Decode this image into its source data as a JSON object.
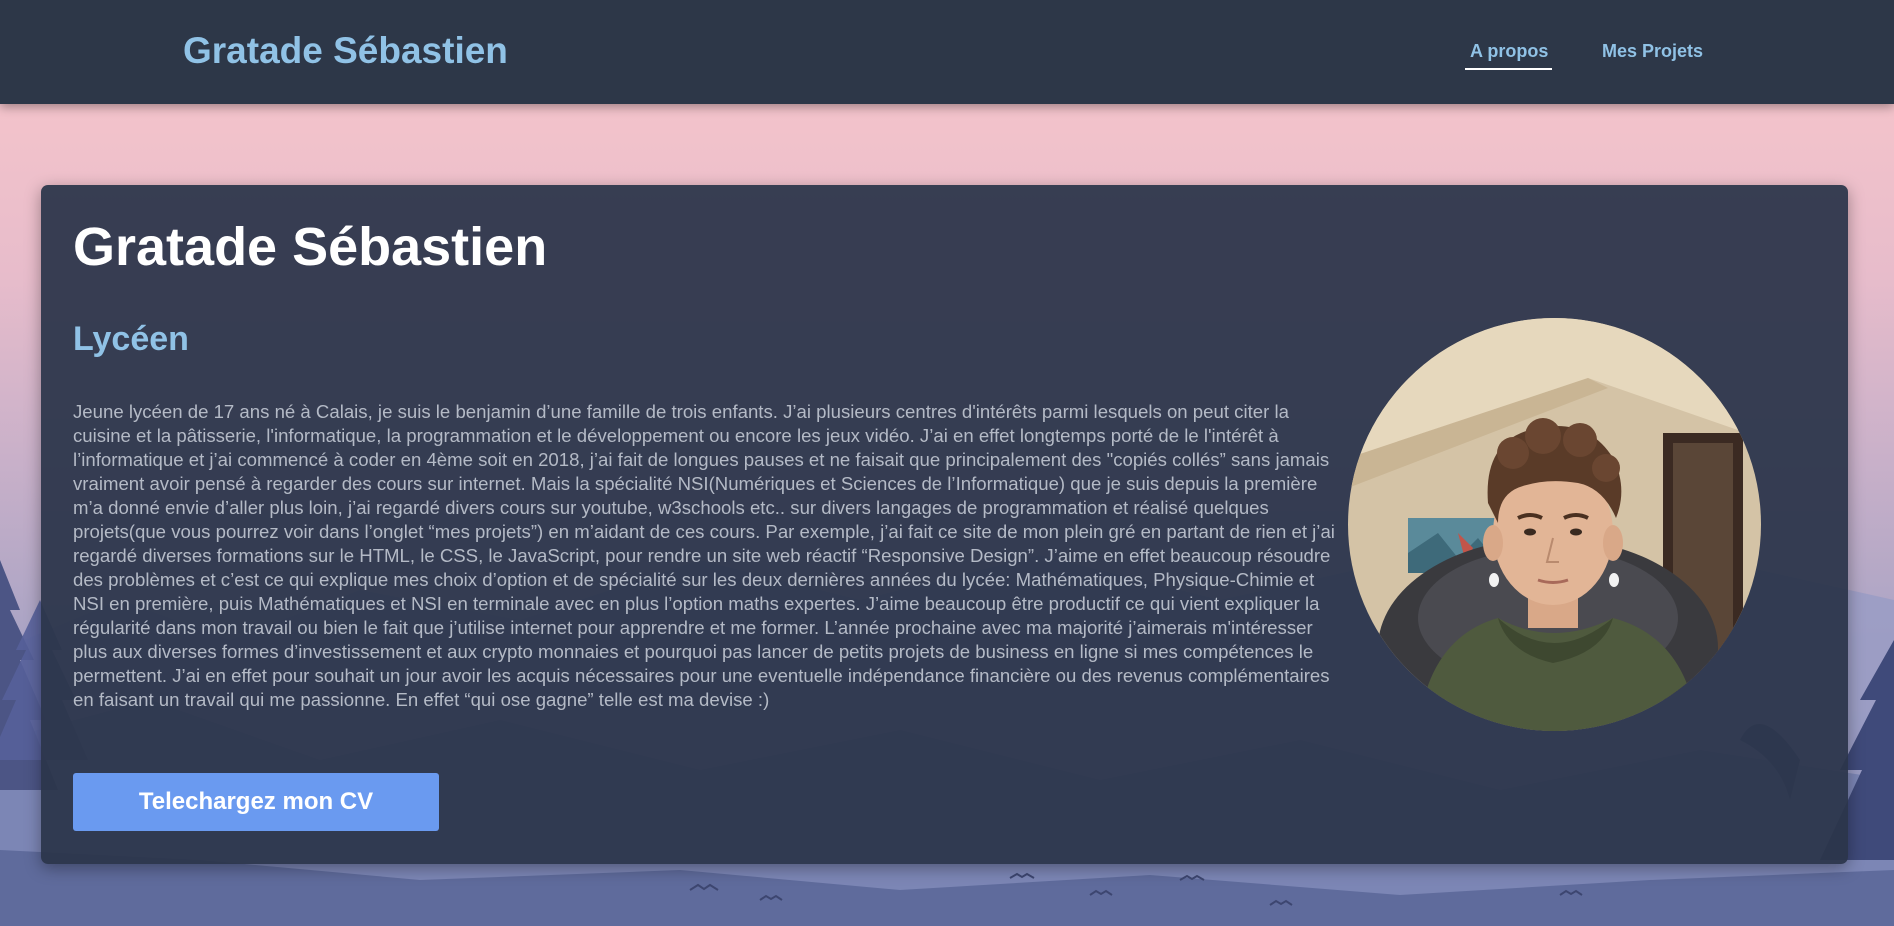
{
  "header": {
    "brand": "Gratade Sébastien",
    "nav": [
      {
        "label": "A propos",
        "active": true
      },
      {
        "label": "Mes Projets",
        "active": false
      }
    ]
  },
  "main": {
    "title": "Gratade Sébastien",
    "subtitle": "Lycéen",
    "bio": "Jeune lycéen de 17 ans né à Calais, je suis le benjamin d’une famille de trois enfants. J’ai plusieurs centres d'intérêts parmi lesquels on peut citer la cuisine et la pâtisserie, l'informatique, la programmation et le développement ou encore les jeux vidéo. J’ai en effet longtemps porté de le l'intérêt à l’informatique et j’ai commencé à coder en 4ème soit en 2018, j’ai fait de longues pauses et ne faisait que principalement des \"copiés collés” sans jamais vraiment avoir pensé à regarder des cours sur internet. Mais la spécialité NSI(Numériques et Sciences de l’Informatique) que je suis depuis la première m’a donné envie d’aller plus loin, j’ai regardé divers cours sur youtube, w3schools etc.. sur divers langages de programmation et réalisé quelques projets(que vous pourrez voir dans l’onglet “mes projets”) en m’aidant de ces cours. Par exemple, j’ai fait ce site de mon plein gré en partant de rien et j’ai regardé diverses formations sur le HTML, le CSS, le JavaScript, pour rendre un site web réactif “Responsive Design”. J’aime en effet beaucoup résoudre des problèmes et c’est ce qui explique mes choix d’option et de spécialité sur les deux dernières années du lycée: Mathématiques, Physique-Chimie et NSI en première, puis Mathématiques et NSI en terminale avec en plus l’option maths expertes. J’aime beaucoup être productif ce qui vient expliquer la régularité dans mon travail ou bien le fait que j’utilise internet pour apprendre et me former. L’année prochaine avec ma majorité j’aimerais m'intéresser plus aux diverses formes d’investissement et aux crypto monnaies et pourquoi pas lancer de petits projets de business en ligne si mes compétences le permettent. J’ai en effet pour souhait un jour avoir les acquis nécessaires pour une eventuelle indépendance financière ou des revenus complémentaires en faisant un travail qui me passionne. En effet “qui ose gagne” telle est ma devise :)",
    "cv_button": "Telechargez mon CV"
  },
  "colors": {
    "navbar": "#2d3748",
    "accent": "#90c2e6",
    "card": "#2c354a",
    "button": "#6a9af0",
    "body_text": "#b4bac6"
  }
}
